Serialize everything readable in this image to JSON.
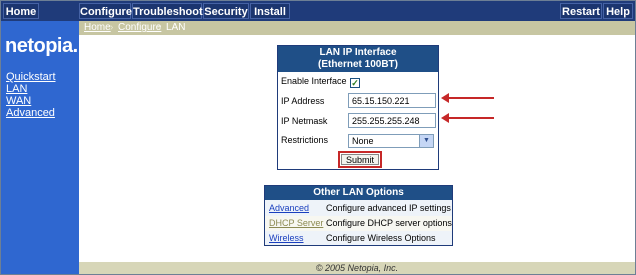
{
  "topnav": {
    "home": "Home",
    "configure": "Configure",
    "troubleshoot": "Troubleshoot",
    "security": "Security",
    "install": "Install",
    "restart": "Restart",
    "help": "Help"
  },
  "sidebar": {
    "logo": "netopia.",
    "links": [
      "Quickstart",
      "LAN",
      "WAN",
      "Advanced"
    ]
  },
  "breadcrumb": [
    "Home",
    "Configure",
    "LAN"
  ],
  "lan_panel": {
    "title_line1": "LAN IP Interface",
    "title_line2": "(Ethernet 100BT)",
    "enable_label": "Enable Interface",
    "enable_checked": true,
    "ip_address_label": "IP Address",
    "ip_address_value": "65.15.150.221",
    "netmask_label": "IP Netmask",
    "netmask_value": "255.255.255.248",
    "restrictions_label": "Restrictions",
    "restrictions_value": "None",
    "submit_label": "Submit"
  },
  "other_options": {
    "title": "Other LAN Options",
    "rows": [
      {
        "link": "Advanced",
        "desc": "Configure advanced IP settings"
      },
      {
        "link": "DHCP Server",
        "desc": "Configure DHCP server options"
      },
      {
        "link": "Wireless",
        "desc": "Configure Wireless Options"
      }
    ]
  },
  "footer": "© 2005 Netopia, Inc.",
  "colors": {
    "nav_bg": "#1f3b7a",
    "sidebar_bg": "#2f67d0",
    "annotation": "#c62828",
    "panel_head": "#1f4f87"
  }
}
